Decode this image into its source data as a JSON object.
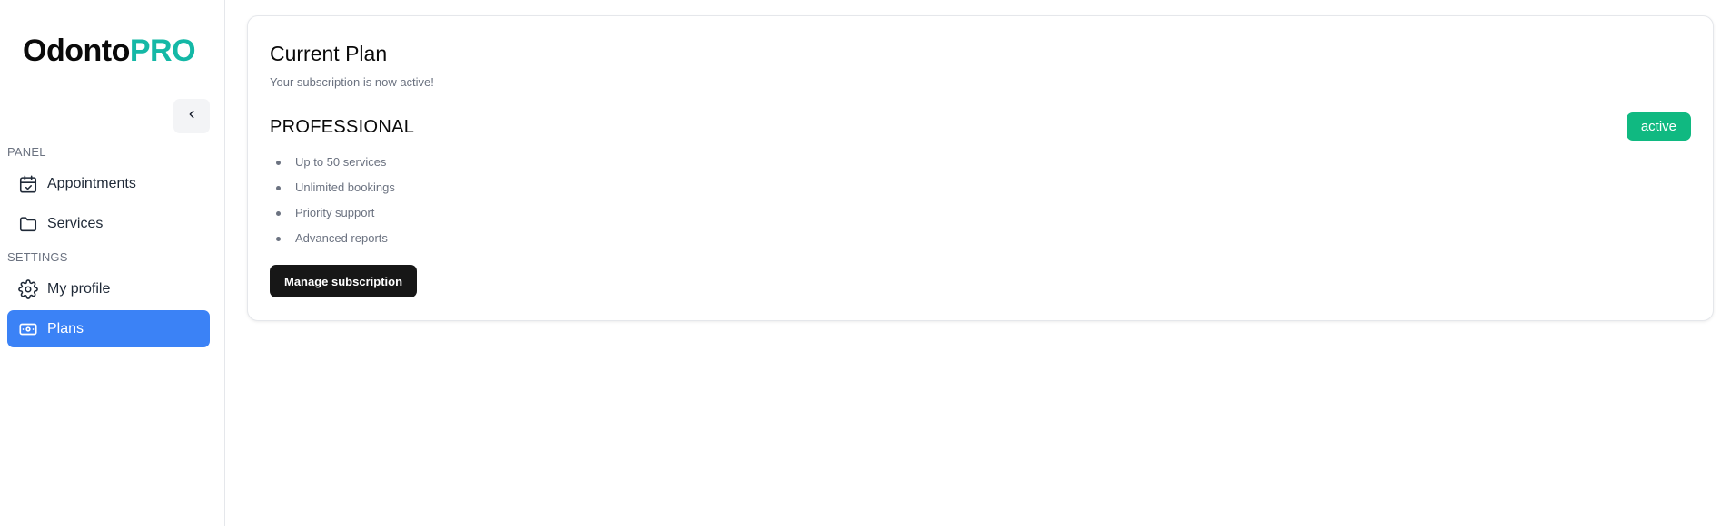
{
  "brand": {
    "part1": "Odonto",
    "part2": "PRO",
    "accent_color": "#14b8a6"
  },
  "sidebar": {
    "collapse_icon": "chevron-left-icon",
    "sections": [
      {
        "label": "PANEL"
      },
      {
        "label": "SETTINGS"
      }
    ],
    "items": [
      {
        "label": "Appointments",
        "icon": "calendar-check-icon"
      },
      {
        "label": "Services",
        "icon": "folder-icon"
      },
      {
        "label": "My profile",
        "icon": "gear-icon"
      },
      {
        "label": "Plans",
        "icon": "banknote-icon",
        "active": true
      }
    ],
    "active_color": "#3b82f6"
  },
  "plan_card": {
    "title": "Current Plan",
    "subtitle": "Your subscription is now active!",
    "plan_name": "PROFESSIONAL",
    "status": "active",
    "status_color": "#10b981",
    "features": [
      "Up to 50 services",
      "Unlimited bookings",
      "Priority support",
      "Advanced reports"
    ],
    "manage_label": "Manage subscription"
  }
}
